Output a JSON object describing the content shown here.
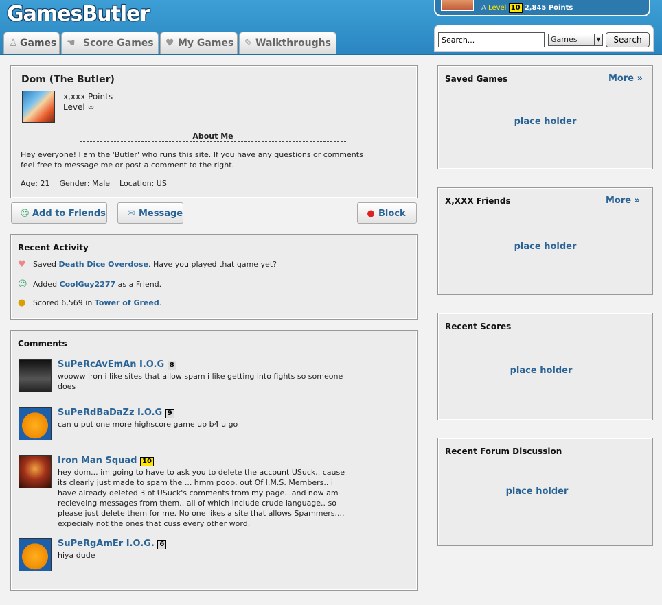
{
  "header": {
    "logo": "GamesButler",
    "user": {
      "prefix": "A",
      "level_label": "Level",
      "level": "10",
      "points": "2,845 Points"
    },
    "tabs": [
      {
        "label": "Games",
        "icon": "joystick-icon"
      },
      {
        "label": "Score Games",
        "icon": "hand-icon"
      },
      {
        "label": "My Games",
        "icon": "heart-icon"
      },
      {
        "label": "Walkthroughs",
        "icon": "wrench-icon"
      }
    ],
    "search": {
      "value": "Search...",
      "select": "Games",
      "button": "Search"
    }
  },
  "profile": {
    "name": "Dom (The Butler)",
    "points": "x,xxx Points",
    "level": "Level ∞",
    "about_title": "About Me",
    "about_text": "Hey everyone! I am the 'Butler' who runs this site. If you have any questions or comments feel free to message me or post a comment to the right.",
    "details": "Age: 21    Gender: Male    Location: US"
  },
  "actions": {
    "add": "Add to Friends",
    "message": "Message",
    "block": "Block"
  },
  "activity": {
    "title": "Recent Activity",
    "items": [
      {
        "pre": "Saved ",
        "link": "Death Dice Overdose",
        "post": ". Have you played that game yet?"
      },
      {
        "pre": "Added ",
        "link": "CoolGuy2277",
        "post": " as a Friend."
      },
      {
        "pre": "Scored 6,569 in ",
        "link": "Tower of Greed",
        "post": "."
      }
    ]
  },
  "comments": {
    "title": "Comments",
    "items": [
      {
        "name": "SuPeRcAvEmAn I.O.G",
        "level": "8",
        "text": "wooww iron i like sites that allow spam i like getting into fights so someone does"
      },
      {
        "name": "SuPeRdBaDaZz I.O.G",
        "level": "9",
        "text": "can u put one more highscore game up b4 u go"
      },
      {
        "name": "Iron Man Squad",
        "level": "10",
        "text": "hey dom... im going to have to ask you to delete the account USuck.. cause its clearly just made to spam the ... hmm poop. out Of I.M.S. Members.. i have already deleted 3 of USuck's comments from my page.. and now am recieveing messages from them.. all of which include crude language.. so please just delete them for me. No one likes a site that allows Spammers.... expecialy not the ones that cuss every other word."
      },
      {
        "name": "SuPeRgAmEr I.O.G.",
        "level": "6",
        "text": "hiya dude"
      }
    ]
  },
  "sidebar": {
    "saved": {
      "title": "Saved Games",
      "more": "More »",
      "placeholder": "place holder"
    },
    "friends": {
      "title": "X,XXX Friends",
      "more": "More »",
      "placeholder": "place holder"
    },
    "scores": {
      "title": "Recent Scores",
      "placeholder": "place holder"
    },
    "forum": {
      "title": "Recent Forum Discussion",
      "placeholder": "place holder"
    }
  }
}
